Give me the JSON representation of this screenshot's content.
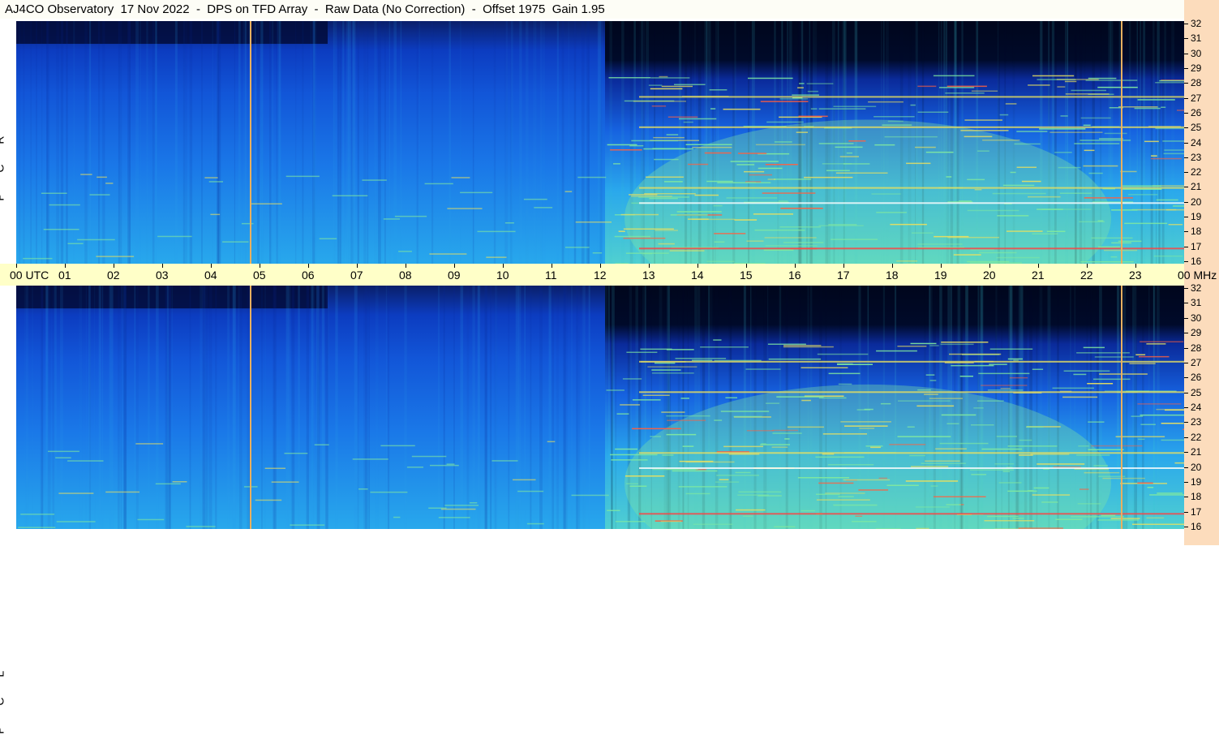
{
  "title": "AJ4CO Observatory  17 Nov 2022  -  DPS on TFD Array  -  Raw Data (No Correction)  -  Offset 1975  Gain 1.95",
  "panels": [
    {
      "label": "R C P"
    },
    {
      "label": "L C P"
    }
  ],
  "chart_data": {
    "type": "heatmap",
    "title": "AJ4CO Observatory  17 Nov 2022  -  DPS on TFD Array  -  Raw Data (No Correction)  -  Offset 1975  Gain 1.95",
    "xlabel": "UTC",
    "ylabel": "MHz",
    "x_ticks": [
      "00 UTC",
      "01",
      "02",
      "03",
      "04",
      "05",
      "06",
      "07",
      "08",
      "09",
      "10",
      "11",
      "12",
      "13",
      "14",
      "15",
      "16",
      "17",
      "18",
      "19",
      "20",
      "21",
      "22",
      "23",
      "00 MHz"
    ],
    "xlim": [
      0,
      24
    ],
    "y_ticks": [
      "32",
      "31",
      "30",
      "29",
      "28",
      "27",
      "26",
      "25",
      "24",
      "23",
      "22",
      "21",
      "20",
      "19",
      "18",
      "17",
      "16"
    ],
    "ylim": [
      16,
      32
    ],
    "series": [
      {
        "name": "R C P",
        "night_start_hour": 12.1,
        "hot_channels_mhz": [
          17.0,
          20.0,
          21.0,
          25.0,
          27.0
        ]
      },
      {
        "name": "L C P",
        "night_start_hour": 12.1,
        "hot_channels_mhz": [
          17.0,
          20.0,
          21.0,
          25.0,
          27.0
        ]
      }
    ],
    "vertical_markers_hours": [
      4.8,
      22.7
    ],
    "colormap": [
      "#000a2a",
      "#0a2a9a",
      "#1660e0",
      "#1c8cf0",
      "#30c0e8",
      "#80e8a0",
      "#e8e060",
      "#ff4040",
      "#ffffff"
    ]
  }
}
